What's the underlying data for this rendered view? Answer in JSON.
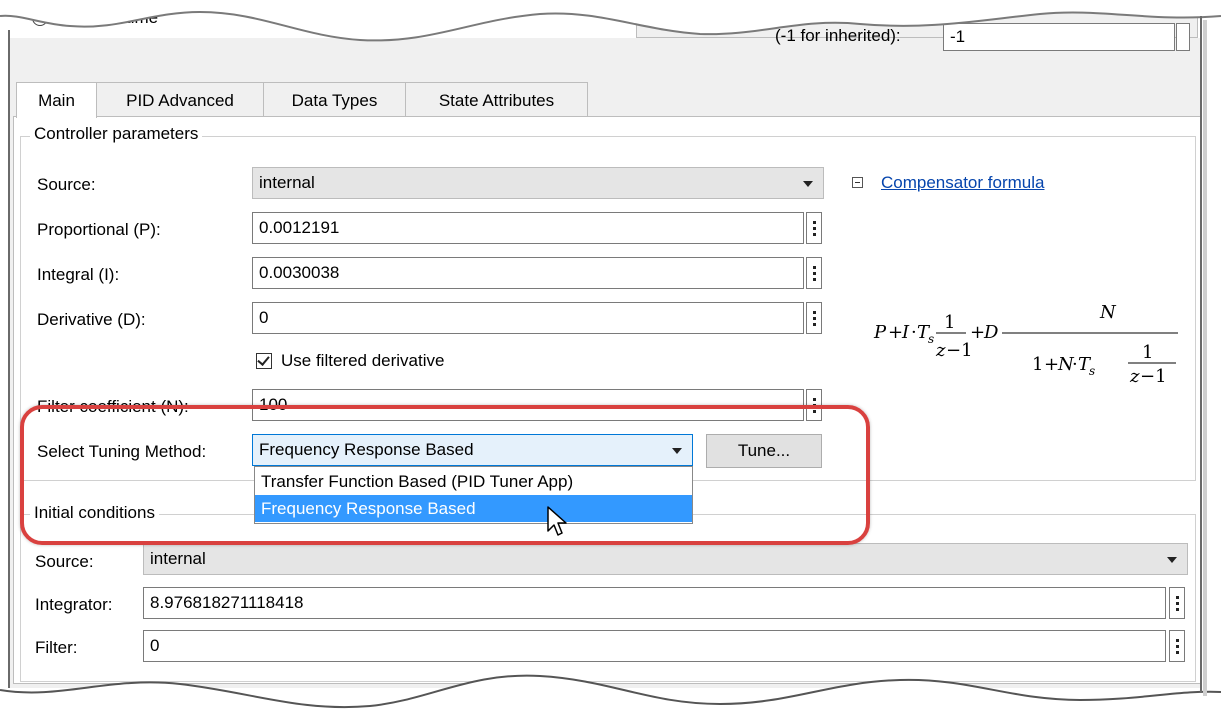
{
  "top": {
    "radio_label": "Discrete-time",
    "sample_label": "(-1 for inherited):",
    "sample_value": "-1"
  },
  "tabs": [
    {
      "label": "Main",
      "active": true
    },
    {
      "label": "PID Advanced",
      "active": false
    },
    {
      "label": "Data Types",
      "active": false
    },
    {
      "label": "State Attributes",
      "active": false
    }
  ],
  "controller": {
    "group_title": "Controller parameters",
    "source_label": "Source:",
    "source_value": "internal",
    "p_label": "Proportional (P):",
    "p_value": "0.0012191",
    "i_label": "Integral (I):",
    "i_value": "0.0030038",
    "d_label": "Derivative (D):",
    "d_value": "0",
    "filtered_label": "Use filtered derivative",
    "filtered_checked": true,
    "n_label": "Filter coefficient (N):",
    "n_value": "100",
    "tuning_label": "Select Tuning Method:",
    "tuning_value": "Frequency Response Based",
    "tune_button": "Tune...",
    "formula_link": "Compensator formula"
  },
  "dropdown": {
    "options": [
      "Transfer Function Based (PID Tuner App)",
      "Frequency Response Based"
    ],
    "selected_index": 1
  },
  "initial": {
    "group_title": "Initial conditions",
    "source_label": "Source:",
    "source_value": "internal",
    "integrator_label": "Integrator:",
    "integrator_value": "8.976818271118418",
    "filter_label": "Filter:",
    "filter_value": "0"
  },
  "colors": {
    "highlight": "#d9413f",
    "selection": "#3399ff",
    "link": "#0645ad",
    "panel": "#f0f0f0"
  }
}
